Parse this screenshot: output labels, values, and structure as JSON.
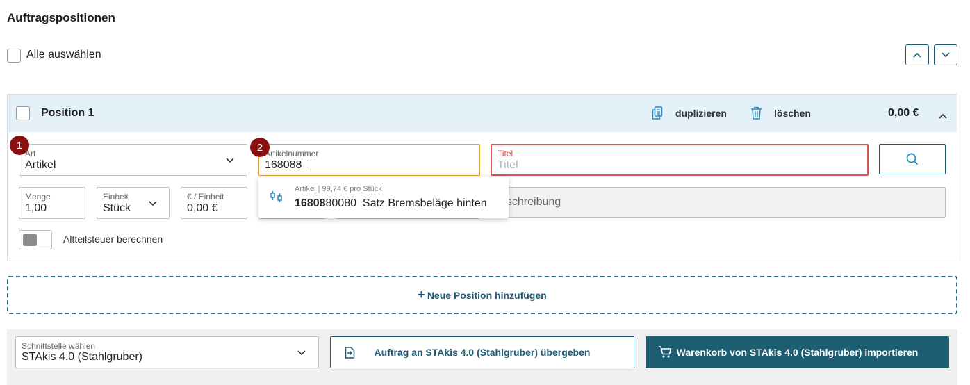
{
  "section_title": "Auftragspositionen",
  "select_all_label": "Alle auswählen",
  "position": {
    "title": "Position 1",
    "duplicate_label": "duplizieren",
    "delete_label": "löschen",
    "total": "0,00 €"
  },
  "fields": {
    "art": {
      "label": "Art",
      "value": "Artikel",
      "badge": "1"
    },
    "artikelnummer": {
      "label": "Artikelnummer",
      "value": "168088",
      "badge": "2"
    },
    "titel": {
      "label": "Titel",
      "placeholder": "Titel"
    },
    "menge": {
      "label": "Menge",
      "value": "1,00"
    },
    "einheit": {
      "label": "Einheit",
      "value": "Stück"
    },
    "preis": {
      "label": "€ / Einheit",
      "value": "0,00 €"
    },
    "beschreibung": {
      "placeholder": "eschreibung"
    }
  },
  "suggestion": {
    "meta": "Artikel | 99,74 € pro Stück",
    "number_match": "16808",
    "number_rest": "80080",
    "name": "Satz Bremsbeläge hinten"
  },
  "toggle_label": "Altteilsteuer berechnen",
  "add_position_label": "Neue Position hinzufügen",
  "footer": {
    "interface_label": "Schnittstelle wählen",
    "interface_value": "STAkis 4.0 (Stahlgruber)",
    "transfer_button": "Auftrag an STAkis 4.0 (Stahlgruber) übergeben",
    "import_button": "Warenkorb von STAkis 4.0 (Stahlgruber) importieren"
  },
  "colors": {
    "accent": "#1f5a73",
    "header_bg": "#e4f1f8",
    "badge": "#8a1010",
    "active_border": "#e8a33b",
    "error_border": "#d9534f"
  }
}
